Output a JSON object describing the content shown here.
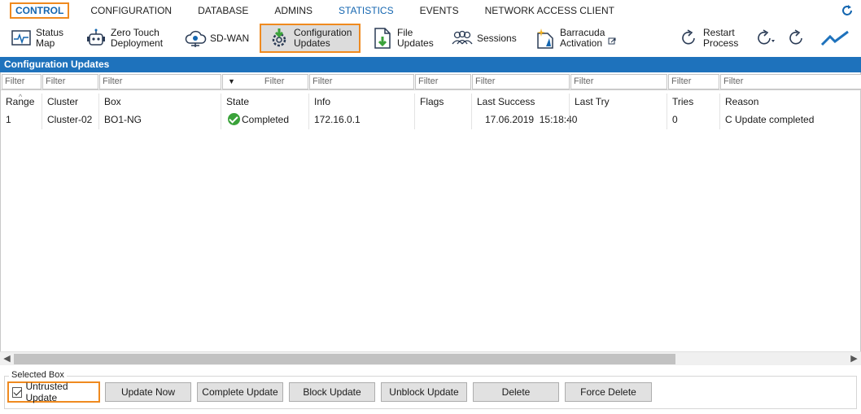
{
  "menu": {
    "items": [
      "CONTROL",
      "CONFIGURATION",
      "DATABASE",
      "ADMINS",
      "STATISTICS",
      "EVENTS",
      "NETWORK ACCESS CLIENT"
    ]
  },
  "toolbar": {
    "status_map": [
      "Status",
      "Map"
    ],
    "zero_touch": [
      "Zero Touch",
      "Deployment"
    ],
    "sdwan": "SD-WAN",
    "config_updates": [
      "Configuration",
      "Updates"
    ],
    "file_updates": [
      "File",
      "Updates"
    ],
    "sessions": "Sessions",
    "barracuda_activation": [
      "Barracuda",
      "Activation"
    ],
    "restart_process": [
      "Restart",
      "Process"
    ]
  },
  "panel": {
    "title": "Configuration Updates"
  },
  "table": {
    "filter_placeholder": "Filter",
    "columns": [
      "Range",
      "Cluster",
      "Box",
      "State",
      "Info",
      "Flags",
      "Last Success",
      "Last Try",
      "Tries",
      "Reason"
    ],
    "rows": [
      {
        "range": "1",
        "cluster": "Cluster-02",
        "box": "BO1-NG",
        "state": "Completed",
        "info": "172.16.0.1",
        "flags": "",
        "last_success": "17.06.2019  15:18:40",
        "last_try": "",
        "tries": "0",
        "reason": "C Update completed"
      }
    ]
  },
  "selected_box": {
    "label": "Selected Box",
    "untrusted_update": "Untrusted Update",
    "buttons": [
      "Update Now",
      "Complete Update",
      "Block Update",
      "Unblock Update",
      "Delete",
      "Force Delete"
    ]
  },
  "colors": {
    "accent": "#1e72bc",
    "highlight": "#ef8a1f",
    "success": "#3aa23a"
  }
}
